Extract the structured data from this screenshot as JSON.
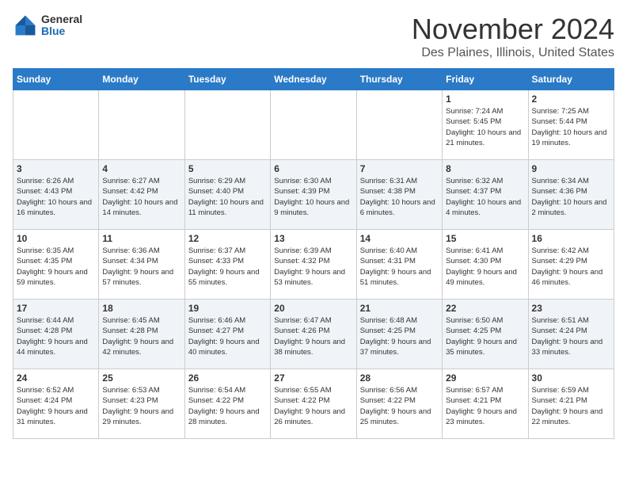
{
  "header": {
    "logo_general": "General",
    "logo_blue": "Blue",
    "month_title": "November 2024",
    "location": "Des Plaines, Illinois, United States"
  },
  "days_of_week": [
    "Sunday",
    "Monday",
    "Tuesday",
    "Wednesday",
    "Thursday",
    "Friday",
    "Saturday"
  ],
  "weeks": [
    [
      {
        "day": "",
        "info": ""
      },
      {
        "day": "",
        "info": ""
      },
      {
        "day": "",
        "info": ""
      },
      {
        "day": "",
        "info": ""
      },
      {
        "day": "",
        "info": ""
      },
      {
        "day": "1",
        "info": "Sunrise: 7:24 AM\nSunset: 5:45 PM\nDaylight: 10 hours and 21 minutes."
      },
      {
        "day": "2",
        "info": "Sunrise: 7:25 AM\nSunset: 5:44 PM\nDaylight: 10 hours and 19 minutes."
      }
    ],
    [
      {
        "day": "3",
        "info": "Sunrise: 6:26 AM\nSunset: 4:43 PM\nDaylight: 10 hours and 16 minutes."
      },
      {
        "day": "4",
        "info": "Sunrise: 6:27 AM\nSunset: 4:42 PM\nDaylight: 10 hours and 14 minutes."
      },
      {
        "day": "5",
        "info": "Sunrise: 6:29 AM\nSunset: 4:40 PM\nDaylight: 10 hours and 11 minutes."
      },
      {
        "day": "6",
        "info": "Sunrise: 6:30 AM\nSunset: 4:39 PM\nDaylight: 10 hours and 9 minutes."
      },
      {
        "day": "7",
        "info": "Sunrise: 6:31 AM\nSunset: 4:38 PM\nDaylight: 10 hours and 6 minutes."
      },
      {
        "day": "8",
        "info": "Sunrise: 6:32 AM\nSunset: 4:37 PM\nDaylight: 10 hours and 4 minutes."
      },
      {
        "day": "9",
        "info": "Sunrise: 6:34 AM\nSunset: 4:36 PM\nDaylight: 10 hours and 2 minutes."
      }
    ],
    [
      {
        "day": "10",
        "info": "Sunrise: 6:35 AM\nSunset: 4:35 PM\nDaylight: 9 hours and 59 minutes."
      },
      {
        "day": "11",
        "info": "Sunrise: 6:36 AM\nSunset: 4:34 PM\nDaylight: 9 hours and 57 minutes."
      },
      {
        "day": "12",
        "info": "Sunrise: 6:37 AM\nSunset: 4:33 PM\nDaylight: 9 hours and 55 minutes."
      },
      {
        "day": "13",
        "info": "Sunrise: 6:39 AM\nSunset: 4:32 PM\nDaylight: 9 hours and 53 minutes."
      },
      {
        "day": "14",
        "info": "Sunrise: 6:40 AM\nSunset: 4:31 PM\nDaylight: 9 hours and 51 minutes."
      },
      {
        "day": "15",
        "info": "Sunrise: 6:41 AM\nSunset: 4:30 PM\nDaylight: 9 hours and 49 minutes."
      },
      {
        "day": "16",
        "info": "Sunrise: 6:42 AM\nSunset: 4:29 PM\nDaylight: 9 hours and 46 minutes."
      }
    ],
    [
      {
        "day": "17",
        "info": "Sunrise: 6:44 AM\nSunset: 4:28 PM\nDaylight: 9 hours and 44 minutes."
      },
      {
        "day": "18",
        "info": "Sunrise: 6:45 AM\nSunset: 4:28 PM\nDaylight: 9 hours and 42 minutes."
      },
      {
        "day": "19",
        "info": "Sunrise: 6:46 AM\nSunset: 4:27 PM\nDaylight: 9 hours and 40 minutes."
      },
      {
        "day": "20",
        "info": "Sunrise: 6:47 AM\nSunset: 4:26 PM\nDaylight: 9 hours and 38 minutes."
      },
      {
        "day": "21",
        "info": "Sunrise: 6:48 AM\nSunset: 4:25 PM\nDaylight: 9 hours and 37 minutes."
      },
      {
        "day": "22",
        "info": "Sunrise: 6:50 AM\nSunset: 4:25 PM\nDaylight: 9 hours and 35 minutes."
      },
      {
        "day": "23",
        "info": "Sunrise: 6:51 AM\nSunset: 4:24 PM\nDaylight: 9 hours and 33 minutes."
      }
    ],
    [
      {
        "day": "24",
        "info": "Sunrise: 6:52 AM\nSunset: 4:24 PM\nDaylight: 9 hours and 31 minutes."
      },
      {
        "day": "25",
        "info": "Sunrise: 6:53 AM\nSunset: 4:23 PM\nDaylight: 9 hours and 29 minutes."
      },
      {
        "day": "26",
        "info": "Sunrise: 6:54 AM\nSunset: 4:22 PM\nDaylight: 9 hours and 28 minutes."
      },
      {
        "day": "27",
        "info": "Sunrise: 6:55 AM\nSunset: 4:22 PM\nDaylight: 9 hours and 26 minutes."
      },
      {
        "day": "28",
        "info": "Sunrise: 6:56 AM\nSunset: 4:22 PM\nDaylight: 9 hours and 25 minutes."
      },
      {
        "day": "29",
        "info": "Sunrise: 6:57 AM\nSunset: 4:21 PM\nDaylight: 9 hours and 23 minutes."
      },
      {
        "day": "30",
        "info": "Sunrise: 6:59 AM\nSunset: 4:21 PM\nDaylight: 9 hours and 22 minutes."
      }
    ]
  ]
}
